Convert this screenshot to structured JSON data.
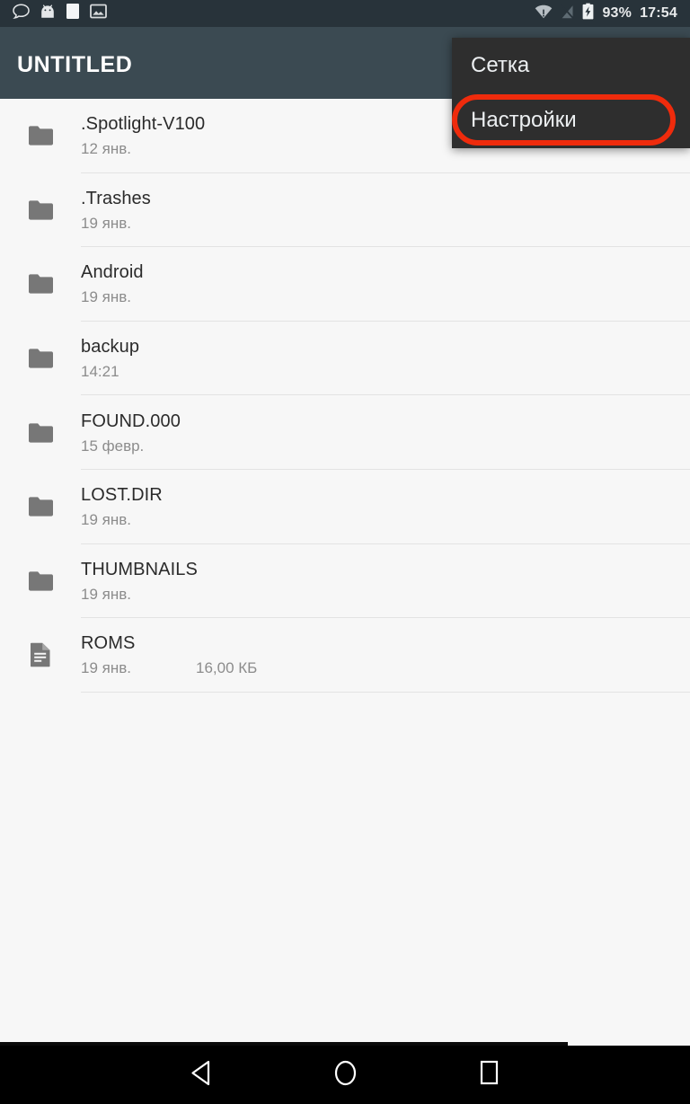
{
  "status_bar": {
    "icons": [
      "message-bubble-icon",
      "android-head-icon",
      "blank-page-icon",
      "photo-icon"
    ],
    "wifi_icon": "wifi-warning-icon",
    "signal_icon": "no-sim-icon",
    "battery_icon": "battery-charging-icon",
    "battery_percent": "93%",
    "clock": "17:54",
    "background_color": "#28333a"
  },
  "app_bar": {
    "title": "UNTITLED",
    "background_color": "#3b4a52"
  },
  "overflow_menu": {
    "background_color": "#2e2e2e",
    "highlight_color": "#ef2b0c",
    "items": [
      {
        "label": "Сетка",
        "name": "menu-item-grid",
        "highlighted": false
      },
      {
        "label": "Настройки",
        "name": "menu-item-settings",
        "highlighted": true
      }
    ]
  },
  "file_list": {
    "rows": [
      {
        "name": ".Spotlight-V100",
        "date": "12 янв.",
        "size": "",
        "icon": "folder-icon"
      },
      {
        "name": ".Trashes",
        "date": "19 янв.",
        "size": "",
        "icon": "folder-icon"
      },
      {
        "name": "Android",
        "date": "19 янв.",
        "size": "",
        "icon": "folder-icon"
      },
      {
        "name": "backup",
        "date": "14:21",
        "size": "",
        "icon": "folder-icon"
      },
      {
        "name": "FOUND.000",
        "date": "15 февр.",
        "size": "",
        "icon": "folder-icon"
      },
      {
        "name": "LOST.DIR",
        "date": "19 янв.",
        "size": "",
        "icon": "folder-icon"
      },
      {
        "name": "THUMBNAILS",
        "date": "19 янв.",
        "size": "",
        "icon": "folder-icon"
      },
      {
        "name": "ROMS",
        "date": "19 янв.",
        "size": "16,00 КБ",
        "icon": "file-icon"
      }
    ]
  },
  "nav_bar": {
    "background_color": "#000000",
    "buttons": [
      {
        "name": "nav-back-button",
        "icon": "triangle-back-icon"
      },
      {
        "name": "nav-home-button",
        "icon": "circle-home-icon"
      },
      {
        "name": "nav-recents-button",
        "icon": "square-recents-icon"
      }
    ]
  }
}
